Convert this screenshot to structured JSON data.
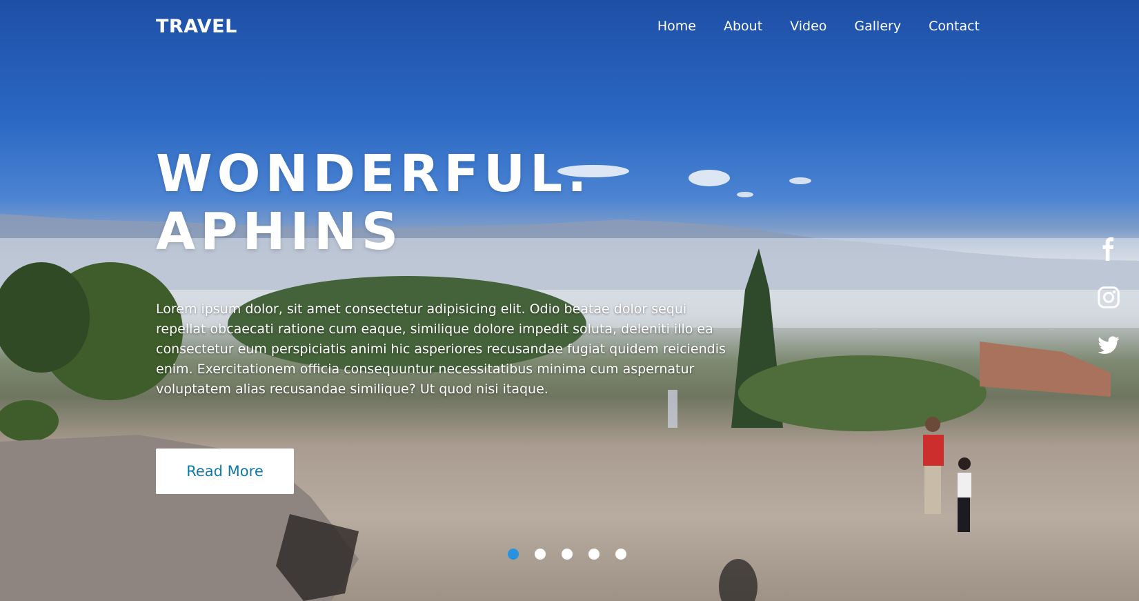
{
  "brand": {
    "logo": "TRAVEL"
  },
  "nav": {
    "items": [
      {
        "label": "Home"
      },
      {
        "label": "About"
      },
      {
        "label": "Video"
      },
      {
        "label": "Gallery"
      },
      {
        "label": "Contact"
      }
    ]
  },
  "hero": {
    "title_line1": "WONDERFUL.",
    "title_line2": "APHINS",
    "description": "Lorem ipsum dolor, sit amet consectetur adipisicing elit. Odio beatae dolor sequi repellat obcaecati ratione cum eaque, similique dolore impedit soluta, deleniti illo ea consectetur eum perspiciatis animi hic asperiores recusandae fugiat quidem reiciendis enim. Exercitationem officia consequuntur necessitatibus minima cum aspernatur voluptatem alias recusandae similique? Ut quod nisi itaque.",
    "button_label": "Read More"
  },
  "social": {
    "icons": [
      "facebook-icon",
      "instagram-icon",
      "twitter-icon"
    ]
  },
  "slider": {
    "count": 5,
    "active_index": 1,
    "active_color": "#2793e0"
  },
  "colors": {
    "button_text": "#1178a8",
    "sky": "#2b68c4"
  }
}
